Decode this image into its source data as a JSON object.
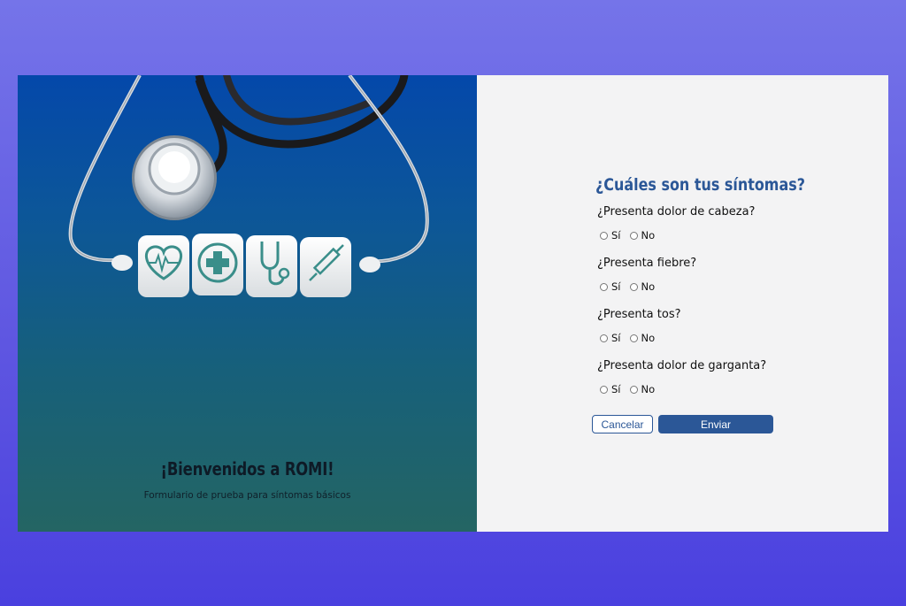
{
  "welcome": {
    "title": "¡Bienvenidos a ROMI!",
    "subtitle": "Formulario de prueba para síntomas básicos"
  },
  "illustration": {
    "icons": [
      "heart-pulse-icon",
      "medical-cross-icon",
      "stethoscope-icon",
      "syringe-icon"
    ]
  },
  "form": {
    "title": "¿Cuáles son tus síntomas?",
    "questions": [
      {
        "label": "¿Presenta dolor de cabeza?",
        "yes": "Sí",
        "no": "No"
      },
      {
        "label": "¿Presenta fiebre?",
        "yes": "Sí",
        "no": "No"
      },
      {
        "label": "¿Presenta tos?",
        "yes": "Sí",
        "no": "No"
      },
      {
        "label": "¿Presenta dolor de garganta?",
        "yes": "Sí",
        "no": "No"
      }
    ],
    "cancel_label": "Cancelar",
    "submit_label": "Enviar"
  },
  "colors": {
    "accent": "#2b5797",
    "background_top": "#7574e9",
    "background_bottom": "#4a40df",
    "panel_left_top": "#0448aa",
    "panel_left_bottom": "#246563",
    "panel_right": "#f3f3f4"
  }
}
